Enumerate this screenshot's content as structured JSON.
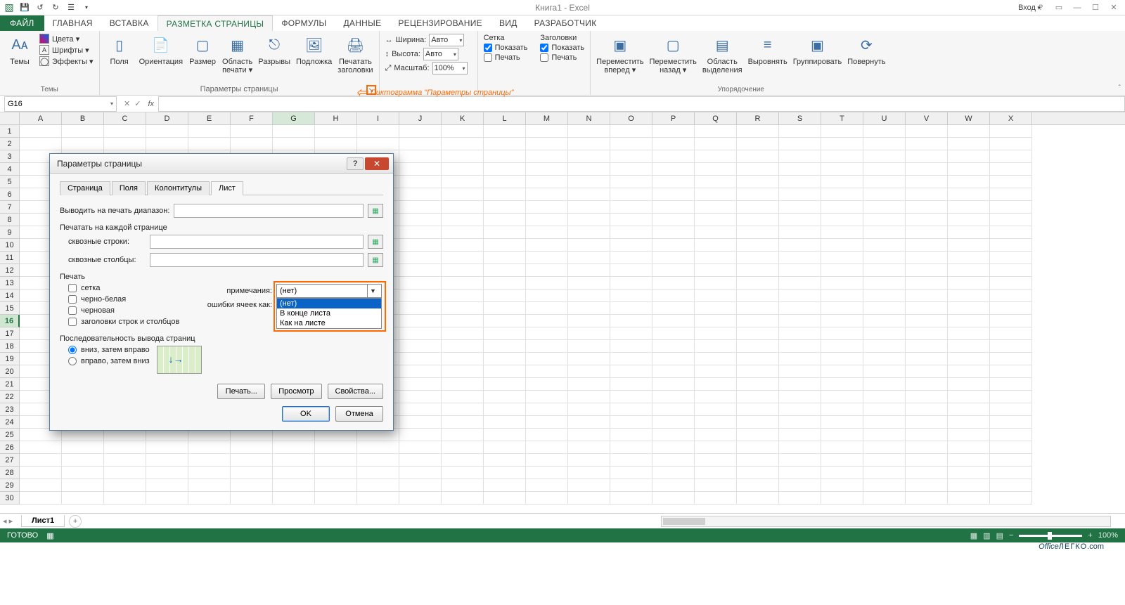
{
  "app_title": "Книга1 - Excel",
  "login": "Вход",
  "ribbon_tabs": {
    "file": "ФАЙЛ",
    "home": "ГЛАВНАЯ",
    "insert": "ВСТАВКА",
    "layout": "РАЗМЕТКА СТРАНИЦЫ",
    "formulas": "ФОРМУЛЫ",
    "data": "ДАННЫЕ",
    "review": "РЕЦЕНЗИРОВАНИЕ",
    "view": "ВИД",
    "developer": "РАЗРАБОТЧИК"
  },
  "ribbon": {
    "themes": {
      "label": "Темы",
      "btn": "Темы",
      "colors": "Цвета ▾",
      "fonts": "Шрифты ▾",
      "effects": "Эффекты ▾"
    },
    "page_setup": {
      "label": "Параметры страницы",
      "margins": "Поля",
      "orientation": "Ориентация",
      "size": "Размер",
      "print_area": "Область\nпечати ▾",
      "breaks": "Разрывы",
      "background": "Подложка",
      "print_titles": "Печатать\nзаголовки"
    },
    "scale": {
      "width_lbl": "Ширина:",
      "width_val": "Авто",
      "height_lbl": "Высота:",
      "height_val": "Авто",
      "scale_lbl": "Масштаб:",
      "scale_val": "100%"
    },
    "grid": {
      "title": "Сетка",
      "show": "Показать",
      "print": "Печать"
    },
    "headings": {
      "title": "Заголовки",
      "show": "Показать",
      "print": "Печать"
    },
    "arrange": {
      "label": "Упорядочение",
      "forward": "Переместить\nвперед ▾",
      "backward": "Переместить\nназад ▾",
      "selection": "Область\nвыделения",
      "align": "Выровнять",
      "group": "Группировать",
      "rotate": "Повернуть"
    }
  },
  "callout_text": "Пиктограмма \"Параметры страницы\"",
  "namebox": "G16",
  "columns": [
    "A",
    "B",
    "C",
    "D",
    "E",
    "F",
    "G",
    "H",
    "I",
    "J",
    "K",
    "L",
    "M",
    "N",
    "O",
    "P",
    "Q",
    "R",
    "S",
    "T",
    "U",
    "V",
    "W",
    "X"
  ],
  "rowcount": 30,
  "selected_col_idx": 6,
  "selected_row": 16,
  "sheet_tab": "Лист1",
  "status": {
    "ready": "ГОТОВО",
    "zoom": "100%"
  },
  "dialog": {
    "title": "Параметры страницы",
    "tabs": {
      "page": "Страница",
      "margins": "Поля",
      "headerfooter": "Колонтитулы",
      "sheet": "Лист"
    },
    "print_range_lbl": "Выводить на печать диапазон:",
    "repeat_lbl": "Печатать на каждой странице",
    "rows_lbl": "сквозные строки:",
    "cols_lbl": "сквозные столбцы:",
    "print_section": "Печать",
    "chk_grid": "сетка",
    "chk_bw": "черно-белая",
    "chk_draft": "черновая",
    "chk_headings": "заголовки строк и столбцов",
    "comments_lbl": "примечания:",
    "errors_lbl": "ошибки ячеек как:",
    "combo_value": "(нет)",
    "combo_options": [
      "(нет)",
      "В конце листа",
      "Как на листе"
    ],
    "order_section": "Последовательность вывода страниц",
    "order_down": "вниз, затем вправо",
    "order_over": "вправо, затем вниз",
    "btn_print": "Печать...",
    "btn_preview": "Просмотр",
    "btn_props": "Свойства...",
    "btn_ok": "OK",
    "btn_cancel": "Отмена"
  },
  "watermark": {
    "a": "Office",
    "b": "ЛЕГКО",
    "c": ".com"
  }
}
